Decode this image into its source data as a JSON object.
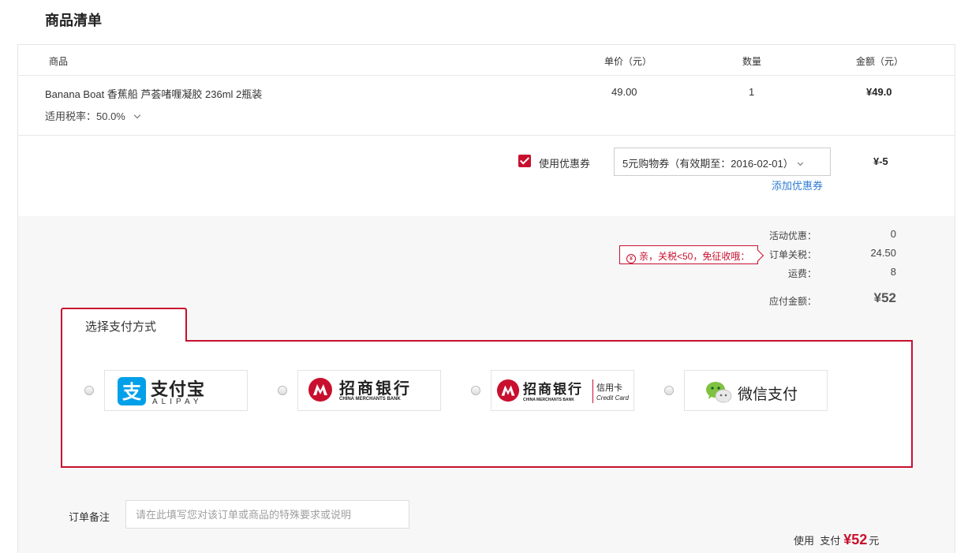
{
  "page": {
    "title": "商品清单"
  },
  "table": {
    "headers": {
      "product": "商品",
      "unit_price": "单价（元）",
      "quantity": "数量",
      "amount": "金额（元）"
    },
    "item": {
      "name": "Banana Boat 香蕉船 芦荟啫喱凝胶 236ml 2瓶装",
      "tax_rate": "适用税率：50.0%",
      "unit_price": "49.00",
      "quantity": "1",
      "amount": "¥49.0"
    }
  },
  "coupon": {
    "checked": true,
    "label": "使用优惠券",
    "selected": "5元购物券（有效期至：2016-02-01）",
    "add_link": "添加优惠券",
    "amount": "¥-5"
  },
  "summary": {
    "promo_label": "活动优惠：",
    "promo_value": "0",
    "tax_tip_icon": "¥",
    "tax_tip": "亲，关税<50，免征收哦：",
    "tax_label": "订单关税：",
    "tax_value": "24.50",
    "shipping_label": "运费：",
    "shipping_value": "8",
    "payable_label": "应付金额：",
    "payable_value": "¥52"
  },
  "payment": {
    "tab_label": "选择支付方式",
    "methods": [
      {
        "id": "alipay",
        "cn": "支付宝",
        "en": "ALIPAY",
        "icon": "alipay-icon",
        "color": "#00a0e9"
      },
      {
        "id": "cmb",
        "cn": "招商银行",
        "en": "CHINA MERCHANTS BANK",
        "icon": "cmb-logo-icon",
        "color": "#c8102e"
      },
      {
        "id": "cmb-credit",
        "cn": "招商银行",
        "en": "CHINA MERCHANTS BANK",
        "extra_cn": "信用卡",
        "extra_en": "Credit Card",
        "icon": "cmb-logo-icon",
        "color": "#c8102e"
      },
      {
        "id": "wechat",
        "cn": "微信支付",
        "icon": "wechat-icon",
        "color": "#7fc241"
      }
    ]
  },
  "remark": {
    "label": "订单备注",
    "placeholder": "请在此填写您对该订单或商品的特殊要求或说明"
  },
  "total": {
    "prefix": "使用",
    "middle": "支付",
    "value": "¥52",
    "suffix": "元"
  },
  "colors": {
    "accent": "#c8102e",
    "link": "#2f7bd1",
    "panel_bg": "#f7f7f7"
  }
}
